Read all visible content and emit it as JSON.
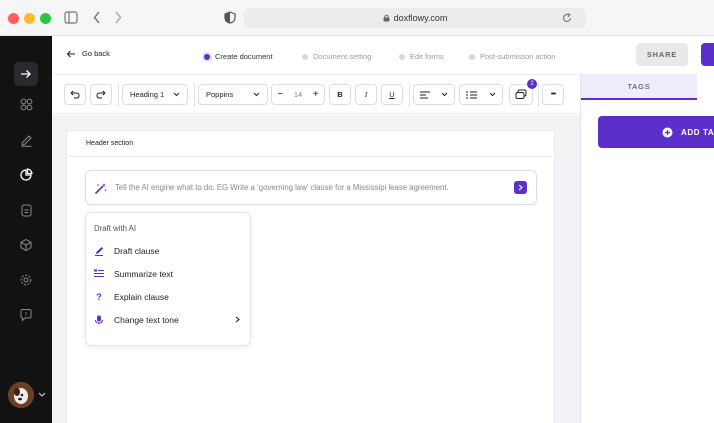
{
  "browser": {
    "url": "doxflowy.com"
  },
  "topbar": {
    "back_label": "Go back",
    "steps": [
      {
        "label": "Create document",
        "active": true
      },
      {
        "label": "Document setting",
        "active": false
      },
      {
        "label": "Edit forms",
        "active": false
      },
      {
        "label": "Post-submisson action",
        "active": false
      }
    ],
    "share_label": "SHARE"
  },
  "toolbar": {
    "heading_select": "Heading 1",
    "font_select": "Poppins",
    "font_size": "14",
    "bold": "B",
    "italic": "I",
    "underline": "U",
    "comment_count": "2",
    "more": "•••"
  },
  "document": {
    "header_section_label": "Header section",
    "ai_prompt_placeholder": "Tell the AI engine what to do. EG Write a ‘governing law’ clause for a Mississipi lease agreement."
  },
  "ai_menu": {
    "title": "Draft with AI",
    "items": [
      {
        "label": "Draft clause",
        "icon": "pen-icon"
      },
      {
        "label": "Summarize text",
        "icon": "list-icon"
      },
      {
        "label": "Explain clause",
        "icon": "question-icon"
      },
      {
        "label": "Change text tone",
        "icon": "microphone-icon"
      }
    ]
  },
  "right_panel": {
    "tab_tags": "TAGS",
    "add_tag_label": "ADD TAG"
  },
  "colors": {
    "accent": "#5b2fc9",
    "sidebar": "#121212",
    "canvas": "#f3f3f5"
  }
}
